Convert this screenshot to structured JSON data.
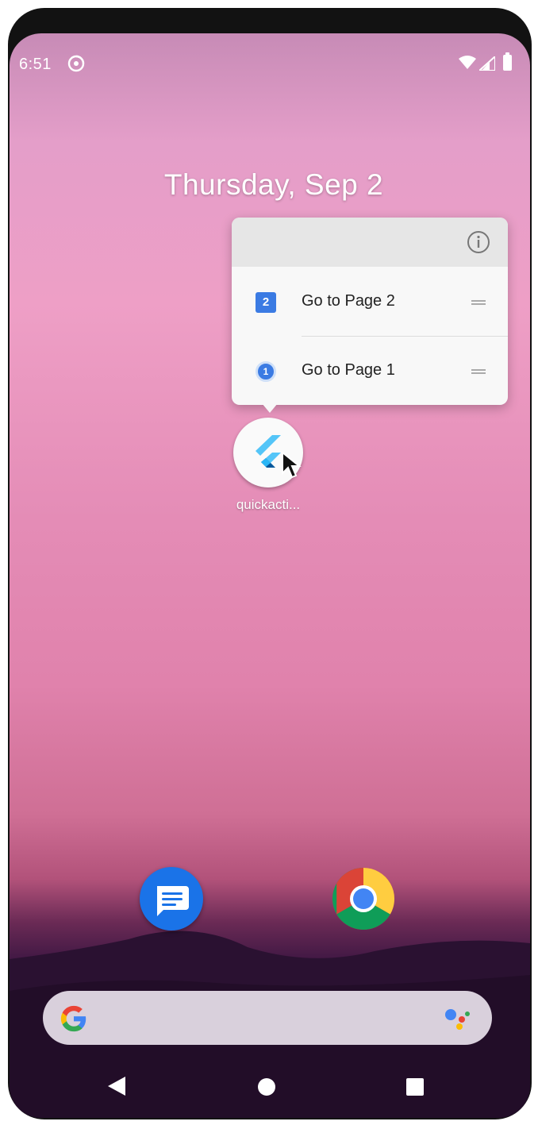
{
  "status_bar": {
    "time": "6:51"
  },
  "date": "Thursday, Sep 2",
  "shortcut_menu": {
    "items": [
      {
        "label": "Go to Page 2",
        "badge": "2"
      },
      {
        "label": "Go to Page 1",
        "badge": "1"
      }
    ]
  },
  "app": {
    "label": "quickacti..."
  },
  "colors": {
    "accent_blue": "#3b7be3",
    "messages_blue": "#1a73e8"
  }
}
